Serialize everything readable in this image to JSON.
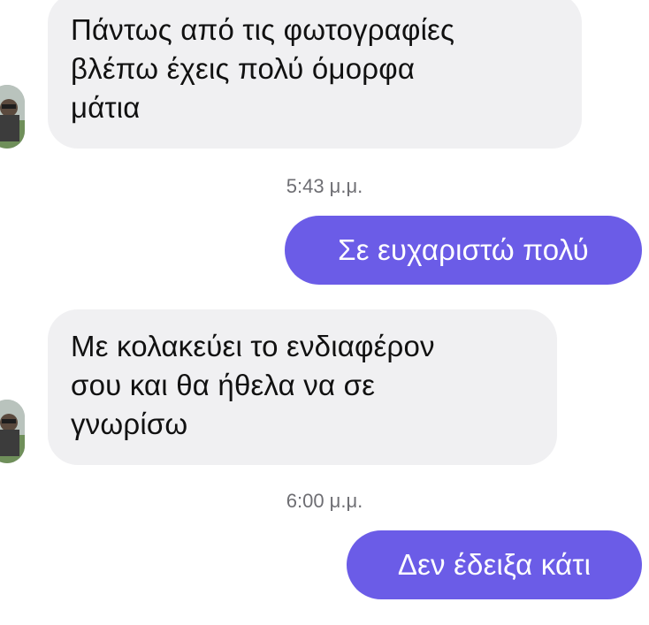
{
  "conversation": {
    "messages": [
      {
        "direction": "incoming",
        "lines": [
          "Πάντως από τις φωτογραφίες",
          "βλέπω έχεις πολύ όμορφα",
          "μάτια"
        ]
      },
      {
        "direction": "outgoing",
        "text": "Σε ευχαριστώ πολύ",
        "time": "5:43 μ.μ."
      },
      {
        "direction": "incoming",
        "lines": [
          "Με κολακεύει το ενδιαφέρον",
          "σου και θα ήθελα να σε",
          "γνωρίσω"
        ]
      },
      {
        "direction": "outgoing",
        "text": "Δεν έδειξα κάτι",
        "time": "6:00 μ.μ."
      }
    ]
  },
  "colors": {
    "incoming_bubble": "#f0f0f2",
    "outgoing_bubble": "#6b5ce7",
    "timestamp_text": "#6e6e73"
  },
  "icons": {
    "sender_avatar": "contact-avatar-photo"
  }
}
